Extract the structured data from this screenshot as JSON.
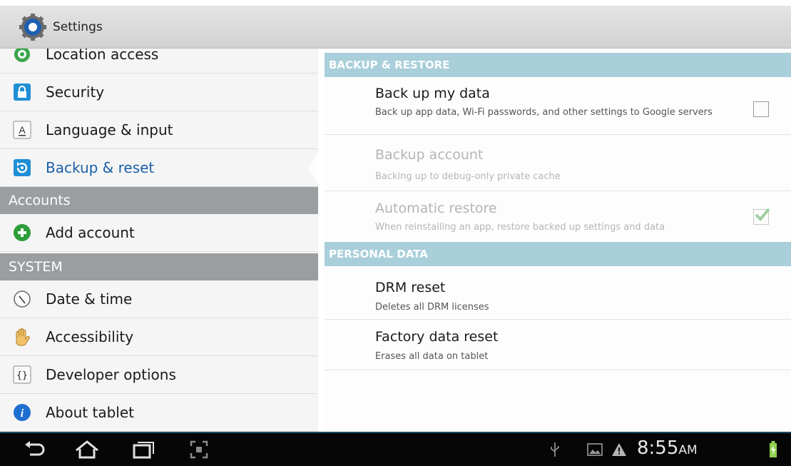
{
  "actionbar": {
    "title": "Settings",
    "icon": "settings-gear-icon"
  },
  "left_menu": {
    "items_top": [
      {
        "label": "Location access",
        "icon": "location-icon"
      },
      {
        "label": "Security",
        "icon": "lock-icon"
      },
      {
        "label": "Language & input",
        "icon": "keyboard-a-icon"
      },
      {
        "label": "Backup & reset",
        "icon": "backup-icon",
        "selected": true
      }
    ],
    "accounts_header": "Accounts",
    "add_account": {
      "label": "Add account",
      "icon": "plus-icon"
    },
    "system_header": "SYSTEM",
    "items_system": [
      {
        "label": "Date & time",
        "icon": "clock-icon"
      },
      {
        "label": "Accessibility",
        "icon": "hand-icon"
      },
      {
        "label": "Developer options",
        "icon": "braces-icon"
      },
      {
        "label": "About tablet",
        "icon": "info-icon"
      }
    ]
  },
  "right_panel": {
    "backup_header": "BACKUP & RESTORE",
    "backup_items": [
      {
        "title": "Back up my data",
        "summary": "Back up app data, Wi-Fi passwords, and other settings to Google servers",
        "checked": false,
        "enabled": true
      },
      {
        "title": "Backup account",
        "summary": "Backing up to debug-only private cache",
        "enabled": false
      },
      {
        "title": "Automatic restore",
        "summary": "When reinstalling an app, restore backed up settings and data",
        "checked": true,
        "enabled": false
      }
    ],
    "personal_header": "PERSONAL DATA",
    "personal_items": [
      {
        "title": "DRM reset",
        "summary": "Deletes all DRM licenses"
      },
      {
        "title": "Factory data reset",
        "summary": "Erases all data on tablet"
      }
    ]
  },
  "navbar": {
    "time": "8:55",
    "ampm": "AM",
    "buttons": [
      "back-icon",
      "home-icon",
      "recent-apps-icon",
      "screenshot-icon"
    ],
    "status_icons": [
      "usb-icon",
      "image-notification-icon",
      "warning-icon",
      "battery-charging-icon"
    ],
    "colors": {
      "accent": "#1b5fa8",
      "section_header": "#a8cfda",
      "gray_header": "#9b9ea0"
    }
  }
}
